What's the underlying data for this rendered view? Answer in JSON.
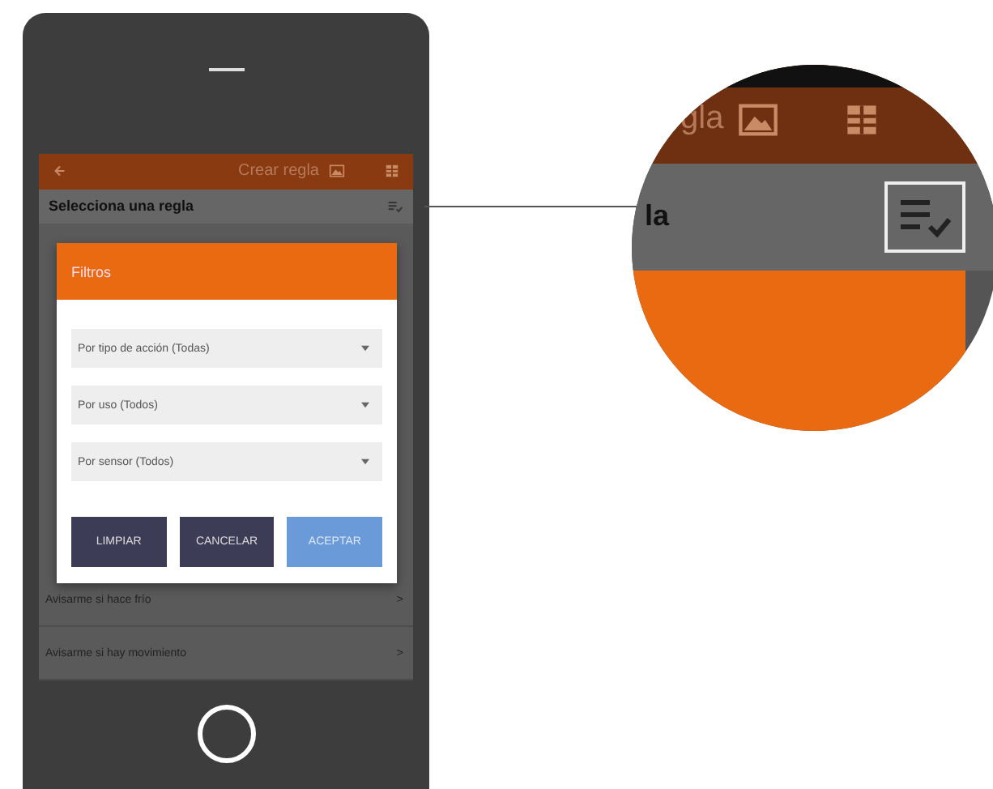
{
  "app_bar": {
    "title": "Crear regla"
  },
  "subheader": {
    "title": "Selecciona una regla"
  },
  "rules": [
    {
      "label": "Avisarme si hace frío",
      "arrow": ">"
    },
    {
      "label": "Avisarme si hay movimiento",
      "arrow": ">"
    }
  ],
  "dialog": {
    "title": "Filtros",
    "dropdowns": [
      {
        "value": "Por tipo de acción (Todas)"
      },
      {
        "value": "Por uso (Todos)"
      },
      {
        "value": "Por sensor (Todos)"
      }
    ],
    "buttons": [
      {
        "label": "LIMPIAR",
        "kind": "secondary"
      },
      {
        "label": "CANCELAR",
        "kind": "secondary"
      },
      {
        "label": "ACEPTAR",
        "kind": "primary"
      }
    ]
  },
  "magnifier": {
    "title_fragment": "gla",
    "subheader_fragment": "la"
  }
}
